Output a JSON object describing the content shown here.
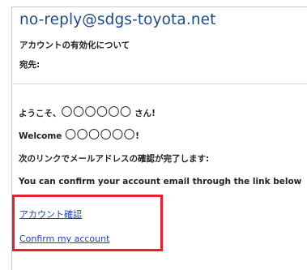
{
  "email": {
    "sender": "no-reply@sdgs-toyota.net",
    "subject": "アカウントの有効化について",
    "to_label": "宛先:"
  },
  "body": {
    "welcome_ja_prefix": "ようこそ、",
    "welcome_ja_name": "〇〇〇〇〇〇",
    "welcome_ja_suffix": " さん!",
    "welcome_en_prefix": "Welcome ",
    "welcome_en_name": "〇〇〇〇〇〇",
    "welcome_en_suffix": "!",
    "confirm_ja": "次のリンクでメールアドレスの確認が完了します:",
    "confirm_en": "You can confirm your account email through the link below"
  },
  "links": {
    "confirm_ja": "アカウント確認",
    "confirm_en": "Confirm my account"
  },
  "colors": {
    "sender": "#1e4a8a",
    "link": "#1f3fbf",
    "highlight": "#e8202a"
  }
}
